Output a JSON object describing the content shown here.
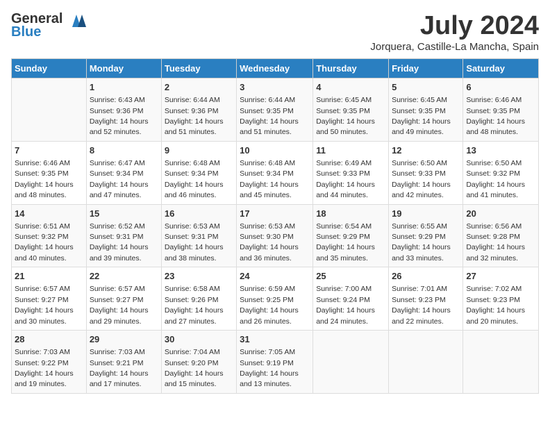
{
  "logo": {
    "general": "General",
    "blue": "Blue"
  },
  "title": "July 2024",
  "location": "Jorquera, Castille-La Mancha, Spain",
  "days_of_week": [
    "Sunday",
    "Monday",
    "Tuesday",
    "Wednesday",
    "Thursday",
    "Friday",
    "Saturday"
  ],
  "weeks": [
    [
      {
        "day": "",
        "sunrise": "",
        "sunset": "",
        "daylight": ""
      },
      {
        "day": "1",
        "sunrise": "Sunrise: 6:43 AM",
        "sunset": "Sunset: 9:36 PM",
        "daylight": "Daylight: 14 hours and 52 minutes."
      },
      {
        "day": "2",
        "sunrise": "Sunrise: 6:44 AM",
        "sunset": "Sunset: 9:36 PM",
        "daylight": "Daylight: 14 hours and 51 minutes."
      },
      {
        "day": "3",
        "sunrise": "Sunrise: 6:44 AM",
        "sunset": "Sunset: 9:35 PM",
        "daylight": "Daylight: 14 hours and 51 minutes."
      },
      {
        "day": "4",
        "sunrise": "Sunrise: 6:45 AM",
        "sunset": "Sunset: 9:35 PM",
        "daylight": "Daylight: 14 hours and 50 minutes."
      },
      {
        "day": "5",
        "sunrise": "Sunrise: 6:45 AM",
        "sunset": "Sunset: 9:35 PM",
        "daylight": "Daylight: 14 hours and 49 minutes."
      },
      {
        "day": "6",
        "sunrise": "Sunrise: 6:46 AM",
        "sunset": "Sunset: 9:35 PM",
        "daylight": "Daylight: 14 hours and 48 minutes."
      }
    ],
    [
      {
        "day": "7",
        "sunrise": "Sunrise: 6:46 AM",
        "sunset": "Sunset: 9:35 PM",
        "daylight": "Daylight: 14 hours and 48 minutes."
      },
      {
        "day": "8",
        "sunrise": "Sunrise: 6:47 AM",
        "sunset": "Sunset: 9:34 PM",
        "daylight": "Daylight: 14 hours and 47 minutes."
      },
      {
        "day": "9",
        "sunrise": "Sunrise: 6:48 AM",
        "sunset": "Sunset: 9:34 PM",
        "daylight": "Daylight: 14 hours and 46 minutes."
      },
      {
        "day": "10",
        "sunrise": "Sunrise: 6:48 AM",
        "sunset": "Sunset: 9:34 PM",
        "daylight": "Daylight: 14 hours and 45 minutes."
      },
      {
        "day": "11",
        "sunrise": "Sunrise: 6:49 AM",
        "sunset": "Sunset: 9:33 PM",
        "daylight": "Daylight: 14 hours and 44 minutes."
      },
      {
        "day": "12",
        "sunrise": "Sunrise: 6:50 AM",
        "sunset": "Sunset: 9:33 PM",
        "daylight": "Daylight: 14 hours and 42 minutes."
      },
      {
        "day": "13",
        "sunrise": "Sunrise: 6:50 AM",
        "sunset": "Sunset: 9:32 PM",
        "daylight": "Daylight: 14 hours and 41 minutes."
      }
    ],
    [
      {
        "day": "14",
        "sunrise": "Sunrise: 6:51 AM",
        "sunset": "Sunset: 9:32 PM",
        "daylight": "Daylight: 14 hours and 40 minutes."
      },
      {
        "day": "15",
        "sunrise": "Sunrise: 6:52 AM",
        "sunset": "Sunset: 9:31 PM",
        "daylight": "Daylight: 14 hours and 39 minutes."
      },
      {
        "day": "16",
        "sunrise": "Sunrise: 6:53 AM",
        "sunset": "Sunset: 9:31 PM",
        "daylight": "Daylight: 14 hours and 38 minutes."
      },
      {
        "day": "17",
        "sunrise": "Sunrise: 6:53 AM",
        "sunset": "Sunset: 9:30 PM",
        "daylight": "Daylight: 14 hours and 36 minutes."
      },
      {
        "day": "18",
        "sunrise": "Sunrise: 6:54 AM",
        "sunset": "Sunset: 9:29 PM",
        "daylight": "Daylight: 14 hours and 35 minutes."
      },
      {
        "day": "19",
        "sunrise": "Sunrise: 6:55 AM",
        "sunset": "Sunset: 9:29 PM",
        "daylight": "Daylight: 14 hours and 33 minutes."
      },
      {
        "day": "20",
        "sunrise": "Sunrise: 6:56 AM",
        "sunset": "Sunset: 9:28 PM",
        "daylight": "Daylight: 14 hours and 32 minutes."
      }
    ],
    [
      {
        "day": "21",
        "sunrise": "Sunrise: 6:57 AM",
        "sunset": "Sunset: 9:27 PM",
        "daylight": "Daylight: 14 hours and 30 minutes."
      },
      {
        "day": "22",
        "sunrise": "Sunrise: 6:57 AM",
        "sunset": "Sunset: 9:27 PM",
        "daylight": "Daylight: 14 hours and 29 minutes."
      },
      {
        "day": "23",
        "sunrise": "Sunrise: 6:58 AM",
        "sunset": "Sunset: 9:26 PM",
        "daylight": "Daylight: 14 hours and 27 minutes."
      },
      {
        "day": "24",
        "sunrise": "Sunrise: 6:59 AM",
        "sunset": "Sunset: 9:25 PM",
        "daylight": "Daylight: 14 hours and 26 minutes."
      },
      {
        "day": "25",
        "sunrise": "Sunrise: 7:00 AM",
        "sunset": "Sunset: 9:24 PM",
        "daylight": "Daylight: 14 hours and 24 minutes."
      },
      {
        "day": "26",
        "sunrise": "Sunrise: 7:01 AM",
        "sunset": "Sunset: 9:23 PM",
        "daylight": "Daylight: 14 hours and 22 minutes."
      },
      {
        "day": "27",
        "sunrise": "Sunrise: 7:02 AM",
        "sunset": "Sunset: 9:23 PM",
        "daylight": "Daylight: 14 hours and 20 minutes."
      }
    ],
    [
      {
        "day": "28",
        "sunrise": "Sunrise: 7:03 AM",
        "sunset": "Sunset: 9:22 PM",
        "daylight": "Daylight: 14 hours and 19 minutes."
      },
      {
        "day": "29",
        "sunrise": "Sunrise: 7:03 AM",
        "sunset": "Sunset: 9:21 PM",
        "daylight": "Daylight: 14 hours and 17 minutes."
      },
      {
        "day": "30",
        "sunrise": "Sunrise: 7:04 AM",
        "sunset": "Sunset: 9:20 PM",
        "daylight": "Daylight: 14 hours and 15 minutes."
      },
      {
        "day": "31",
        "sunrise": "Sunrise: 7:05 AM",
        "sunset": "Sunset: 9:19 PM",
        "daylight": "Daylight: 14 hours and 13 minutes."
      },
      {
        "day": "",
        "sunrise": "",
        "sunset": "",
        "daylight": ""
      },
      {
        "day": "",
        "sunrise": "",
        "sunset": "",
        "daylight": ""
      },
      {
        "day": "",
        "sunrise": "",
        "sunset": "",
        "daylight": ""
      }
    ]
  ]
}
